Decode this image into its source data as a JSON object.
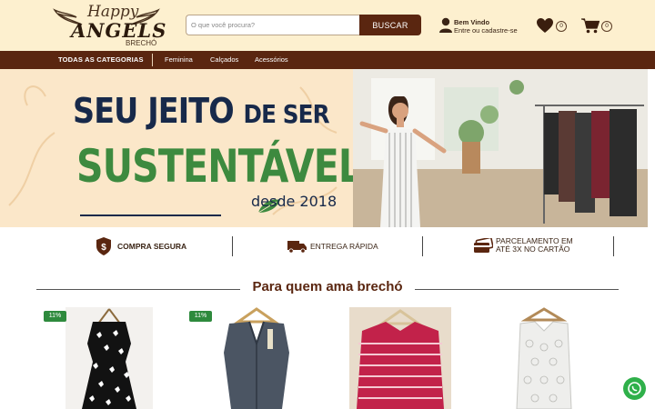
{
  "header": {
    "logo_happy": "Happy",
    "logo_angels": "ANGELS",
    "logo_brecho": "BRECHÓ",
    "search_placeholder": "O que você procura?",
    "search_button": "BUSCAR",
    "account_line1": "Bem Vindo",
    "account_line2": "Entre ou cadastre-se",
    "wishlist_count": "0",
    "cart_count": "0"
  },
  "nav": {
    "all_categories": "TODAS AS CATEGORIAS",
    "items": [
      "Feminina",
      "Calçados",
      "Acessórios"
    ]
  },
  "banner": {
    "line1_a": "SEU JEITO",
    "line1_b": "DE SER",
    "line2": "SUSTENTÁVEL",
    "line3": "desde 2018"
  },
  "features": [
    {
      "label": "COMPRA SEGURA",
      "icon": "shield-dollar-icon"
    },
    {
      "label": "ENTREGA RÁPIDA",
      "icon": "truck-icon"
    },
    {
      "label_line1": "PARCELAMENTO EM",
      "label_line2": "ATÉ 3X NO CARTÃO",
      "icon": "credit-card-icon"
    }
  ],
  "section": {
    "title": "Para quem ama brechó"
  },
  "products": [
    {
      "badge": "11%",
      "description": "black sleeveless dress with white butterfly print"
    },
    {
      "badge": "11%",
      "description": "gray denim sleeveless vest"
    },
    {
      "badge": "",
      "description": "pink and white striped blouse"
    },
    {
      "badge": "",
      "description": "white lace sleeveless top"
    }
  ],
  "colors": {
    "header_bg": "#fdf0cf",
    "brand_brown": "#5a2610",
    "banner_navy": "#17294a",
    "banner_green": "#3d8a3f",
    "badge_green": "#2e8a3d",
    "whatsapp_green": "#2fb04a"
  }
}
